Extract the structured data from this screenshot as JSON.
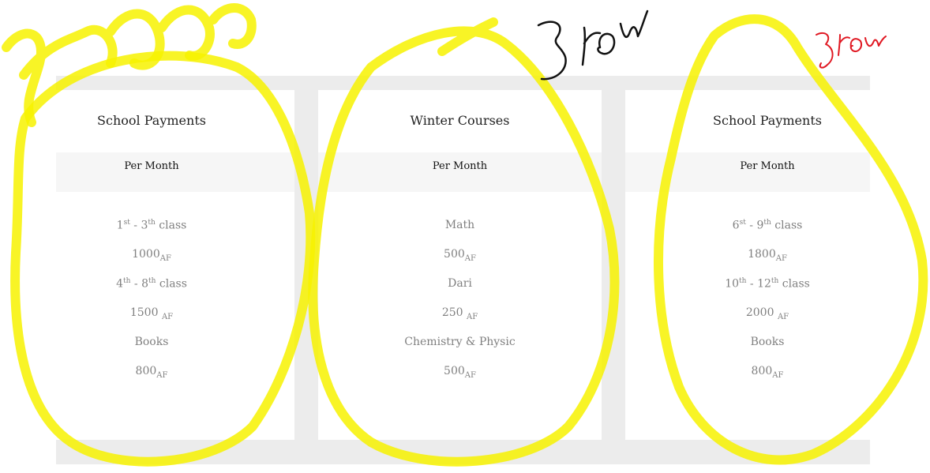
{
  "plans": [
    {
      "title": "School Payments",
      "period": "Per Month",
      "items": [
        {
          "label": {
            "a": "1",
            "a_sup": "st",
            "sep": " - ",
            "b": "3",
            "b_sup": "th",
            "tail": " class"
          }
        },
        {
          "price": {
            "amount": "1000",
            "currency": "AF"
          }
        },
        {
          "label": {
            "a": "4",
            "a_sup": "th",
            "sep": " - ",
            "b": "8",
            "b_sup": "th",
            "tail": " class"
          }
        },
        {
          "price": {
            "amount": "1500 ",
            "currency": "AF"
          }
        },
        {
          "text": "Books"
        },
        {
          "price": {
            "amount": "800",
            "currency": "AF"
          }
        }
      ]
    },
    {
      "title": "Winter Courses",
      "period": "Per Month",
      "items": [
        {
          "text": "Math"
        },
        {
          "price": {
            "amount": "500",
            "currency": "AF"
          }
        },
        {
          "text": "Dari"
        },
        {
          "price": {
            "amount": "250 ",
            "currency": "AF"
          }
        },
        {
          "text": "Chemistry & Physic"
        },
        {
          "price": {
            "amount": "500",
            "currency": "AF"
          }
        }
      ]
    },
    {
      "title": "School Payments",
      "period": "Per Month",
      "items": [
        {
          "label": {
            "a": "6",
            "a_sup": "st",
            "sep": " - ",
            "b": "9",
            "b_sup": "th",
            "tail": " class"
          }
        },
        {
          "price": {
            "amount": "1800",
            "currency": "AF"
          }
        },
        {
          "label": {
            "a": "10",
            "a_sup": "th",
            "sep": " - ",
            "b": "12",
            "b_sup": "th",
            "tail": " class"
          }
        },
        {
          "price": {
            "amount": "2000 ",
            "currency": "AF"
          }
        },
        {
          "text": "Books"
        },
        {
          "price": {
            "amount": "800",
            "currency": "AF"
          }
        }
      ]
    }
  ],
  "colors": {
    "highlighter": "#f7f200",
    "ink_black": "#111111",
    "ink_red": "#e01822"
  }
}
